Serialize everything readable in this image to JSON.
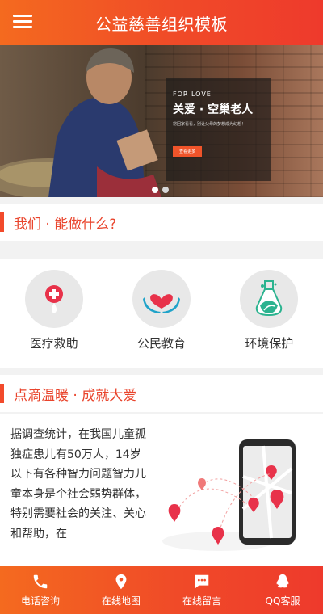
{
  "header": {
    "title": "公益慈善组织模板",
    "menu_icon": "hamburger-menu-icon"
  },
  "banner": {
    "overlay_sub": "FOR LOVE",
    "overlay_title": "关爱 · 空巢老人",
    "overlay_desc": "常回家看看，别让父母的梦想成为幻想！",
    "overlay_button": "查看更多",
    "slide_count": 2,
    "active_slide": 1
  },
  "section1": {
    "title": "我们 · 能做什么?"
  },
  "services": [
    {
      "label": "医疗救助",
      "icon": "medical-drop-icon"
    },
    {
      "label": "公民教育",
      "icon": "heart-hands-icon"
    },
    {
      "label": "环境保护",
      "icon": "leaf-flask-icon"
    }
  ],
  "section2": {
    "title": "点滴温暖 · 成就大爱",
    "text": "据调查统计，在我国儿童孤独症患儿有50万人，14岁以下有各种智力问题智力儿童本身是个社会弱势群体，特别需要社会的关注、关心和帮助，在"
  },
  "footer": [
    {
      "label": "电话咨询",
      "icon": "phone-icon"
    },
    {
      "label": "在线地图",
      "icon": "map-pin-icon"
    },
    {
      "label": "在线留言",
      "icon": "message-icon"
    },
    {
      "label": "QQ客服",
      "icon": "qq-penguin-icon"
    }
  ],
  "colors": {
    "accent": "#f24a2b",
    "accent_orange": "#f46a1f"
  }
}
